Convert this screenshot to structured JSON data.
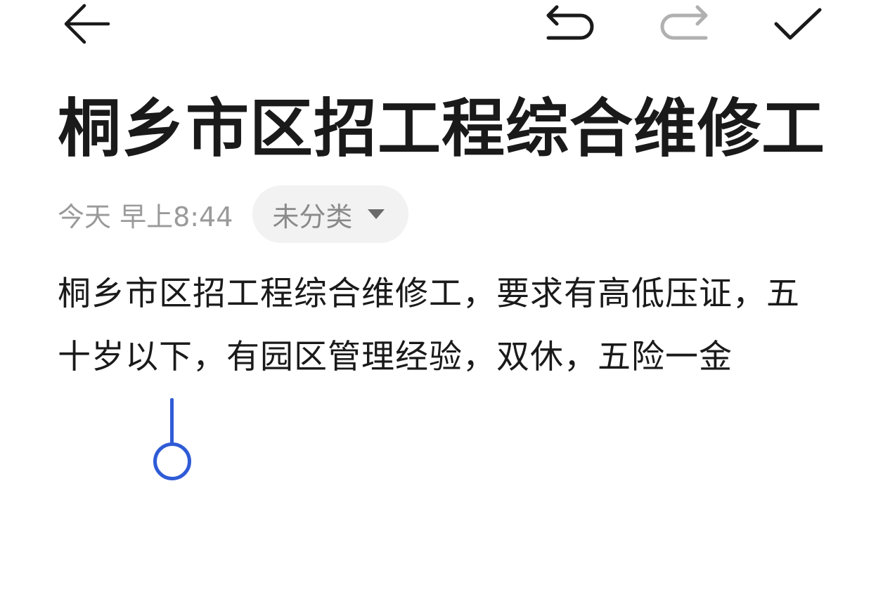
{
  "toolbar": {
    "back_icon": "arrow-left-icon",
    "undo_icon": "undo-icon",
    "redo_icon": "redo-icon",
    "done_icon": "checkmark-icon",
    "icon_color": "#1a1a1a",
    "disabled_color": "#b0b0b0"
  },
  "note": {
    "title": "桐乡市区招工程综合维修工",
    "timestamp": "今天 早上8:44",
    "category": "未分类",
    "body": "桐乡市区招工程综合维修工，要求有高低压证，五十岁以下，有园区管理经验，双休，五险一金"
  },
  "colors": {
    "accent": "#2f5bd6",
    "chip_bg": "#f2f2f2",
    "meta_text": "#9a9a9a"
  }
}
